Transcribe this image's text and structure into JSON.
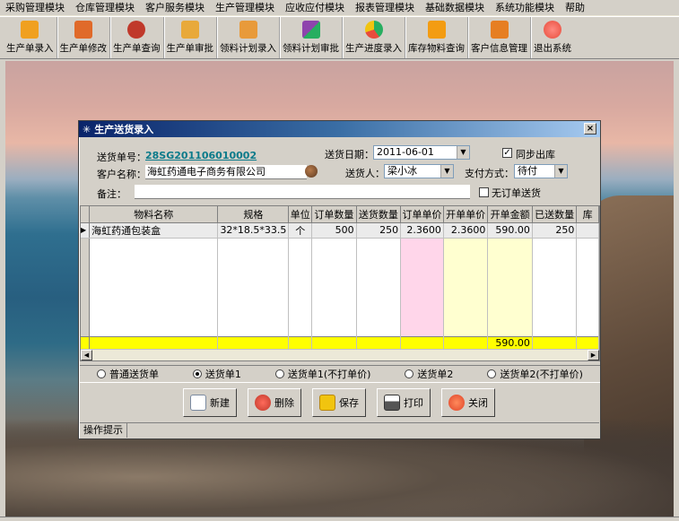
{
  "menu": [
    "采购管理模块",
    "仓库管理模块",
    "客户服务模块",
    "生产管理模块",
    "应收应付模块",
    "报表管理模块",
    "基础数据模块",
    "系统功能模块",
    "帮助"
  ],
  "toolbar": [
    {
      "label": "生产单录入",
      "icon": "box-add-icon",
      "color": "#f0a020"
    },
    {
      "label": "生产单修改",
      "icon": "box-edit-icon",
      "color": "#e06a2a"
    },
    {
      "label": "生产单查询",
      "icon": "search-people-icon",
      "color": "#c0392b"
    },
    {
      "label": "生产单审批",
      "icon": "approve-icon",
      "color": "#e8a93a"
    },
    {
      "label": "领料计划录入",
      "icon": "material-plan-icon",
      "color": "#e89a3a"
    },
    {
      "label": "领料计划审批",
      "icon": "blocks-icon",
      "color": "#8e44ad"
    },
    {
      "label": "生产进度录入",
      "icon": "progress-chart-icon",
      "color": "#27ae60"
    },
    {
      "label": "库存物料查询",
      "icon": "inventory-icon",
      "color": "#f39c12"
    },
    {
      "label": "客户信息管理",
      "icon": "customer-box-icon",
      "color": "#e67e22"
    },
    {
      "label": "退出系统",
      "icon": "exit-icon",
      "color": "#e74c3c"
    }
  ],
  "dialog": {
    "title": "生产送货录入",
    "close": "×",
    "form": {
      "order_no_label": "送货单号：",
      "order_no": "28SG201106010002",
      "date_label": "送货日期：",
      "date": "2011-06-01",
      "sync_label": "同步出库",
      "sync_checked": "✓",
      "customer_label": "客户名称：",
      "customer": "海虹药通电子商务有限公司",
      "deliverer_label": "送货人：",
      "deliverer": "梁小冰",
      "payment_label": "支付方式：",
      "payment": "待付",
      "remark_label": "备注：",
      "remark": "",
      "no_order_label": "无订单送货"
    },
    "grid": {
      "columns": [
        "物料名称",
        "规格",
        "单位",
        "订单数量",
        "送货数量",
        "订单单价",
        "开单单价",
        "开单金额",
        "已送数量",
        "库"
      ],
      "rows": [
        {
          "name": "海虹药通包装盒",
          "spec": "32*18.5*33.5",
          "unit": "个",
          "order_qty": "500",
          "deliver_qty": "250",
          "order_price": "2.3600",
          "bill_price": "2.3600",
          "bill_amount": "590.00",
          "delivered_qty": "250",
          "stock": ""
        }
      ],
      "total_amount": "590.00"
    },
    "radios": [
      {
        "label": "普通送货单",
        "checked": false
      },
      {
        "label": "送货单1",
        "checked": true
      },
      {
        "label": "送货单1(不打单价)",
        "checked": false
      },
      {
        "label": "送货单2",
        "checked": false
      },
      {
        "label": "送货单2(不打单价)",
        "checked": false
      }
    ],
    "buttons": {
      "new": "新建",
      "delete": "删除",
      "save": "保存",
      "print": "打印",
      "close": "关闭"
    },
    "status": "操作提示"
  }
}
